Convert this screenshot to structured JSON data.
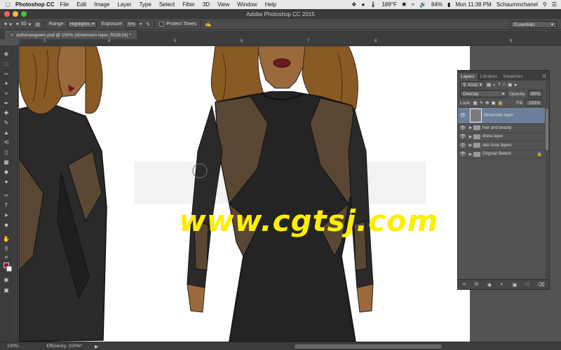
{
  "menubar": {
    "apple_icon": "apple-icon",
    "app_name": "Photoshop CC",
    "items": [
      "File",
      "Edit",
      "Image",
      "Layer",
      "Type",
      "Select",
      "Filter",
      "3D",
      "View",
      "Window",
      "Help"
    ],
    "temperature": "189°F",
    "battery": "84%",
    "clock": "Mon 11:38 PM",
    "user": "Schauminchanel"
  },
  "window": {
    "title": "Adobe Photoshop CC 2015"
  },
  "options": {
    "brush_size": "60",
    "range_label": "Range:",
    "range_value": "Highlights",
    "exposure_label": "Exposure:",
    "exposure_value": "5%",
    "protect_tones": "Protect Tones",
    "workspace": "Essentials"
  },
  "document": {
    "tab": "skillsharegown.psd @ 100% (dimension layer, RGB/16) *",
    "ruler_marks": [
      "3",
      "4",
      "5",
      "6",
      "7",
      "8",
      "9"
    ],
    "zoom": "100%",
    "efficiency": "Efficiency: 100%*"
  },
  "watermark": "www.cgtsj.com",
  "layers_panel": {
    "tabs": [
      "Layers",
      "Libraries",
      "Swatches"
    ],
    "kind_label": "Kind",
    "blend_mode": "Overlay",
    "opacity_label": "Opacity:",
    "opacity_value": "80%",
    "lock_label": "Lock:",
    "fill_label": "Fill:",
    "fill_value": "100%",
    "layers": [
      {
        "name": "dimension layer",
        "type": "layer",
        "selected": true
      },
      {
        "name": "hair and beauty",
        "type": "group"
      },
      {
        "name": "dress layer",
        "type": "group"
      },
      {
        "name": "skin tone layers",
        "type": "group"
      },
      {
        "name": "Original Sketch",
        "type": "group",
        "locked": true
      }
    ]
  },
  "colors": {
    "foreground": "#8b1c36",
    "background": "#ffffff",
    "watermark": "#ffee00",
    "selected_layer": "#6b7f9a"
  }
}
